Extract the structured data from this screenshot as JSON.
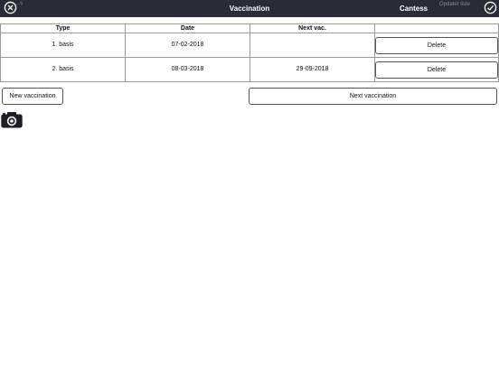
{
  "header": {
    "title": "Vaccination",
    "user": "Cantess",
    "ghost_left": "…s",
    "ghost_right": "Opdatér liste"
  },
  "table": {
    "columns": [
      "Type",
      "Date",
      "Next vac.",
      ""
    ],
    "rows": [
      {
        "type": "1. basis",
        "date": "07-02-2018",
        "next": "",
        "action": "Delete"
      },
      {
        "type": "2. basis",
        "date": "08-03-2018",
        "next": "29-09-2018",
        "action": "Delete"
      }
    ]
  },
  "actions": {
    "new_vaccination": "New vaccination",
    "next_vaccination": "Next vaccination"
  },
  "icons": {
    "close": "close-circle-icon",
    "confirm": "checkmark-circle-icon",
    "camera": "camera-icon"
  },
  "colors": {
    "header_bg": "#2b2b38",
    "header_text": "#ffffff",
    "border": "#9a9a9a"
  }
}
